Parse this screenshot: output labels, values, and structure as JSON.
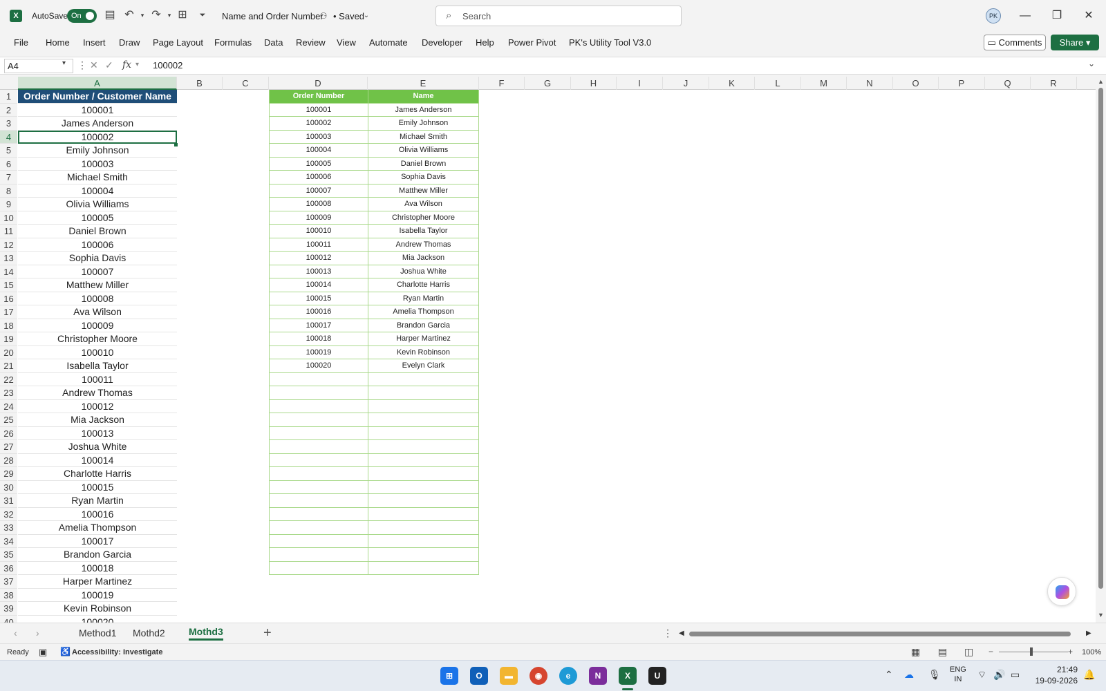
{
  "titlebar": {
    "autosave_label": "AutoSave",
    "autosave_state": "On",
    "doc_title": "Name and Order Number",
    "saved_status": "• Saved",
    "search_placeholder": "Search",
    "icons": [
      "excel-logo",
      "save-icon",
      "undo-icon",
      "redo-icon",
      "table-icon",
      "customize-icon",
      "avatar",
      "minimize-icon",
      "restore-icon",
      "close-icon"
    ]
  },
  "ribbon": {
    "tabs": [
      "File",
      "Home",
      "Insert",
      "Draw",
      "Page Layout",
      "Formulas",
      "Data",
      "Review",
      "View",
      "Automate",
      "Developer",
      "Help",
      "Power Pivot",
      "PK's Utility Tool V3.0"
    ],
    "comments_label": "Comments",
    "share_label": "Share"
  },
  "formula_bar": {
    "name_box": "A4",
    "fx_label": "fx",
    "value": "100002"
  },
  "grid": {
    "columns": [
      "A",
      "B",
      "C",
      "D",
      "E",
      "F",
      "G",
      "H",
      "I",
      "J",
      "K",
      "L",
      "M",
      "N",
      "O",
      "P",
      "Q",
      "R"
    ],
    "active_column": "A",
    "active_row": 4,
    "rows": [
      "1",
      "2",
      "3",
      "4",
      "5",
      "6",
      "7",
      "8",
      "9",
      "10",
      "11",
      "12",
      "13",
      "14",
      "15",
      "16",
      "17",
      "18",
      "19",
      "20",
      "21",
      "22",
      "23",
      "24",
      "25",
      "26",
      "27",
      "28",
      "29",
      "30",
      "31",
      "32",
      "33",
      "34",
      "35",
      "36",
      "37",
      "38",
      "39",
      "40"
    ],
    "column_a": [
      "Order Number / Customer Name",
      "100001",
      "James Anderson",
      "100002",
      "Emily Johnson",
      "100003",
      "Michael Smith",
      "100004",
      "Olivia Williams",
      "100005",
      "Daniel Brown",
      "100006",
      "Sophia Davis",
      "100007",
      "Matthew Miller",
      "100008",
      "Ava Wilson",
      "100009",
      "Christopher Moore",
      "100010",
      "Isabella Taylor",
      "100011",
      "Andrew Thomas",
      "100012",
      "Mia Jackson",
      "100013",
      "Joshua White",
      "100014",
      "Charlotte Harris",
      "100015",
      "Ryan Martin",
      "100016",
      "Amelia Thompson",
      "100017",
      "Brandon Garcia",
      "100018",
      "Harper Martinez",
      "100019",
      "Kevin Robinson",
      "100020"
    ],
    "table": {
      "headers": [
        "Order Number",
        "Name"
      ],
      "rows": [
        [
          "100001",
          "James Anderson"
        ],
        [
          "100002",
          "Emily Johnson"
        ],
        [
          "100003",
          "Michael Smith"
        ],
        [
          "100004",
          "Olivia Williams"
        ],
        [
          "100005",
          "Daniel Brown"
        ],
        [
          "100006",
          "Sophia Davis"
        ],
        [
          "100007",
          "Matthew Miller"
        ],
        [
          "100008",
          "Ava Wilson"
        ],
        [
          "100009",
          "Christopher Moore"
        ],
        [
          "100010",
          "Isabella Taylor"
        ],
        [
          "100011",
          "Andrew Thomas"
        ],
        [
          "100012",
          "Mia Jackson"
        ],
        [
          "100013",
          "Joshua White"
        ],
        [
          "100014",
          "Charlotte Harris"
        ],
        [
          "100015",
          "Ryan Martin"
        ],
        [
          "100016",
          "Amelia Thompson"
        ],
        [
          "100017",
          "Brandon Garcia"
        ],
        [
          "100018",
          "Harper Martinez"
        ],
        [
          "100019",
          "Kevin Robinson"
        ],
        [
          "100020",
          "Evelyn Clark"
        ],
        [
          "",
          ""
        ],
        [
          "",
          ""
        ],
        [
          "",
          ""
        ],
        [
          "",
          ""
        ],
        [
          "",
          ""
        ],
        [
          "",
          ""
        ],
        [
          "",
          ""
        ],
        [
          "",
          ""
        ],
        [
          "",
          ""
        ],
        [
          "",
          ""
        ],
        [
          "",
          ""
        ],
        [
          "",
          ""
        ],
        [
          "",
          ""
        ],
        [
          "",
          ""
        ],
        [
          "",
          ""
        ]
      ]
    }
  },
  "sheets": {
    "tabs": [
      "Method1",
      "Mothd2",
      "Mothd3"
    ],
    "active": "Mothd3"
  },
  "status": {
    "ready": "Ready",
    "accessibility": "Accessibility: Investigate",
    "zoom": "100%",
    "zoom_level_pct": 100
  },
  "taskbar": {
    "apps": [
      "windows-start-icon",
      "outlook-icon",
      "file-explorer-icon",
      "chrome-icon",
      "edge-icon",
      "onenote-icon",
      "excel-icon",
      "utility-icon"
    ],
    "lang_line1": "ENG",
    "lang_line2": "IN",
    "time": "21:49",
    "date": "19-09-2026"
  },
  "colors": {
    "excel_green": "#1d6f42",
    "header_blue": "#1f4e78",
    "table_green": "#70c248"
  }
}
